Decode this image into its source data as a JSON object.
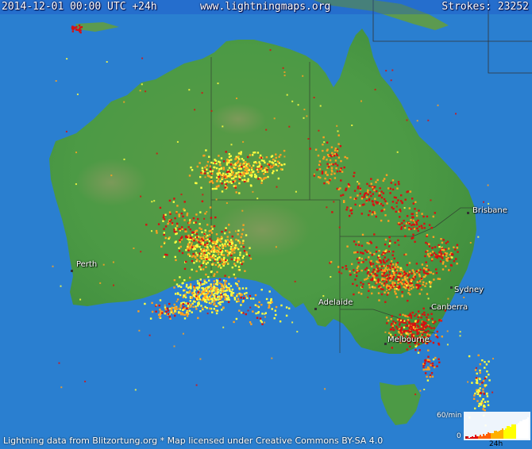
{
  "header": {
    "datetime": "2014-12-01 00:00 UTC +24h",
    "site": "www.lightningmaps.org",
    "strokes_label": "Strokes: 23252"
  },
  "cities": [
    {
      "name": "Brisbane"
    },
    {
      "name": "Sydney"
    },
    {
      "name": "Canberra"
    },
    {
      "name": "Melbourne"
    },
    {
      "name": "Adelaide"
    },
    {
      "name": "Perth"
    }
  ],
  "footer": "Lightning data from Blitzortung.org  *  Map licensed under Creative Commons BY-SA 4.0",
  "histogram": {
    "rate_label": "60/min",
    "zero_label": "0",
    "span_label": "24h",
    "colors": [
      "#ffffff",
      "#ffff00",
      "#ffb000",
      "#ff6000",
      "#e00000",
      "#a00000"
    ]
  },
  "colors": {
    "ocean": "#2a7fd0",
    "land": "#4c9a45",
    "recent": "#ffff40",
    "mid": "#ffa020",
    "old": "#d81010"
  }
}
